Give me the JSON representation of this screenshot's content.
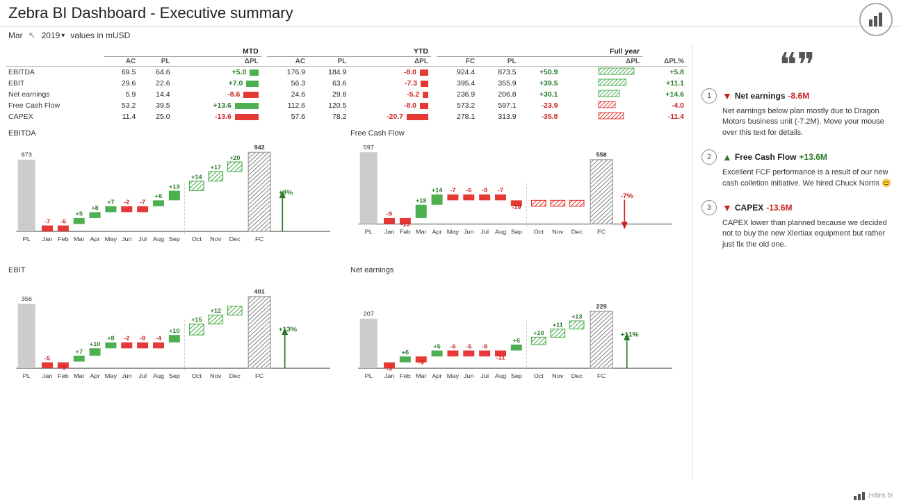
{
  "header": {
    "title": "Zebra BI Dashboard - Executive summary",
    "logo_icon": "bar-chart-icon"
  },
  "toolbar": {
    "month_label": "Mar",
    "year_value": "2019",
    "currency_label": "values in mUSD"
  },
  "table": {
    "sections": [
      "MTD",
      "YTD",
      "Full year"
    ],
    "col_headers_mtd": [
      "AC",
      "PL",
      "ΔPL"
    ],
    "col_headers_ytd": [
      "AC",
      "PL",
      "ΔPL"
    ],
    "col_headers_fy": [
      "FC",
      "PL",
      "ΔPL",
      "ΔPL%"
    ],
    "rows": [
      {
        "label": "EBITDA",
        "mtd_ac": "69.5",
        "mtd_pl": "64.6",
        "mtd_dpl": "+5.0",
        "mtd_dpl_sign": "pos",
        "ytd_ac": "176.9",
        "ytd_pl": "184.9",
        "ytd_dpl": "-8.0",
        "ytd_dpl_sign": "neg",
        "fy_fc": "924.4",
        "fy_pl": "873.5",
        "fy_dpl": "+50.9",
        "fy_dpl_sign": "pos",
        "fy_dpct": "+5.8",
        "fy_dpct_sign": "pos"
      },
      {
        "label": "EBIT",
        "mtd_ac": "29.6",
        "mtd_pl": "22.6",
        "mtd_dpl": "+7.0",
        "mtd_dpl_sign": "pos",
        "ytd_ac": "56.3",
        "ytd_pl": "63.6",
        "ytd_dpl": "-7.3",
        "ytd_dpl_sign": "neg",
        "fy_fc": "395.4",
        "fy_pl": "355.9",
        "fy_dpl": "+39.5",
        "fy_dpl_sign": "pos",
        "fy_dpct": "+11.1",
        "fy_dpct_sign": "pos"
      },
      {
        "label": "Net earnings",
        "mtd_ac": "5.9",
        "mtd_pl": "14.4",
        "mtd_dpl": "-8.6",
        "mtd_dpl_sign": "neg",
        "ytd_ac": "24.6",
        "ytd_pl": "29.8",
        "ytd_dpl": "-5.2",
        "ytd_dpl_sign": "neg",
        "fy_fc": "236.9",
        "fy_pl": "206.8",
        "fy_dpl": "+30.1",
        "fy_dpl_sign": "pos",
        "fy_dpct": "+14.6",
        "fy_dpct_sign": "pos"
      },
      {
        "label": "Free Cash Flow",
        "mtd_ac": "53.2",
        "mtd_pl": "39.5",
        "mtd_dpl": "+13.6",
        "mtd_dpl_sign": "pos",
        "ytd_ac": "112.6",
        "ytd_pl": "120.5",
        "ytd_dpl": "-8.0",
        "ytd_dpl_sign": "neg",
        "fy_fc": "573.2",
        "fy_pl": "597.1",
        "fy_dpl": "-23.9",
        "fy_dpl_sign": "neg",
        "fy_dpct": "-4.0",
        "fy_dpct_sign": "neg"
      },
      {
        "label": "CAPEX",
        "mtd_ac": "11.4",
        "mtd_pl": "25.0",
        "mtd_dpl": "-13.6",
        "mtd_dpl_sign": "neg",
        "ytd_ac": "57.6",
        "ytd_pl": "78.2",
        "ytd_dpl": "-20.7",
        "ytd_dpl_sign": "neg",
        "fy_fc": "278.1",
        "fy_pl": "313.9",
        "fy_dpl": "-35.8",
        "fy_dpl_sign": "neg",
        "fy_dpct": "-11.4",
        "fy_dpct_sign": "neg"
      }
    ]
  },
  "charts": {
    "ebitda": {
      "title": "EBITDA",
      "start_val": "873",
      "end_val": "942",
      "pct_label": "+8%",
      "pct_sign": "pos"
    },
    "free_cash_flow": {
      "title": "Free Cash Flow",
      "start_val": "597",
      "end_val": "558",
      "pct_label": "-7%",
      "pct_sign": "neg"
    },
    "ebit": {
      "title": "EBIT",
      "start_val": "356",
      "end_val": "401",
      "pct_label": "+13%",
      "pct_sign": "pos"
    },
    "net_earnings": {
      "title": "Net earnings",
      "start_val": "207",
      "end_val": "229",
      "pct_label": "+11%",
      "pct_sign": "pos"
    }
  },
  "insights": {
    "quote_icon": "❝",
    "items": [
      {
        "number": "1",
        "direction": "down",
        "title": "Net earnings",
        "value": "-8.6M",
        "body": "Net earnings below plan mostly due to Dragon Motors business unit (-7.2M). Move your mouse over this text for details."
      },
      {
        "number": "2",
        "direction": "up",
        "title": "Free Cash Flow",
        "value": "+13.6M",
        "body": "Excellent FCF performance is a result of our new cash colletion initiative. We hired Chuck Norris 😊"
      },
      {
        "number": "3",
        "direction": "down",
        "title": "CAPEX",
        "value": "-13.6M",
        "body": "CAPEX lower than planned because we decided not to buy the new Xlertiax equipment but rather just fix the old one."
      }
    ]
  },
  "footer": {
    "brand": "zebra bi"
  }
}
